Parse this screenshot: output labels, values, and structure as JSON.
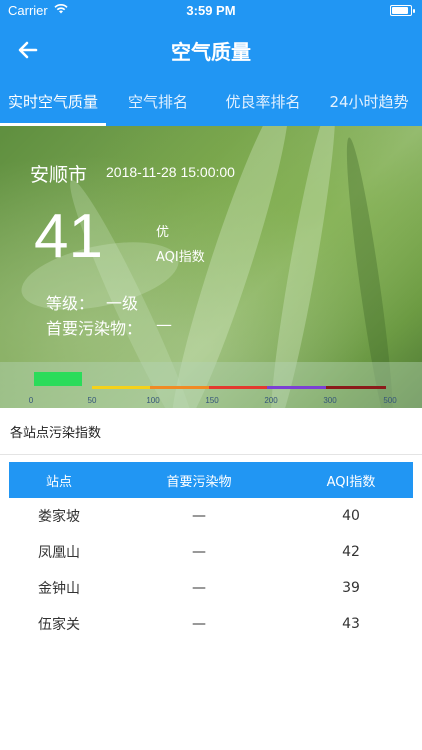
{
  "status_bar": {
    "carrier": "Carrier",
    "time": "3:59 PM"
  },
  "nav": {
    "title": "空气质量"
  },
  "tabs": [
    {
      "label": "实时空气质量",
      "active": true
    },
    {
      "label": "空气排名",
      "active": false
    },
    {
      "label": "优良率排名",
      "active": false
    },
    {
      "label": "24小时趋势",
      "active": false
    }
  ],
  "hero": {
    "city": "安顺市",
    "datetime": "2018-11-28 15:00:00",
    "aqi": "41",
    "quality": "优",
    "aqi_label": "AQI指数",
    "level_label": "等级：",
    "level_value": "一级",
    "pollutant_label": "首要污染物：",
    "pollutant_value": "—",
    "scale": {
      "ticks": [
        "0",
        "50",
        "100",
        "150",
        "200",
        "300",
        "500"
      ],
      "colors": [
        "#f5d21a",
        "#f08a24",
        "#e33a2e",
        "#7b3fd4",
        "#8b1a1a"
      ],
      "indicator_color": "#2bdc5a"
    }
  },
  "stations": {
    "title": "各站点污染指数",
    "headers": [
      "站点",
      "首要污染物",
      "AQI指数"
    ],
    "rows": [
      [
        "娄家坡",
        "—",
        "40"
      ],
      [
        "凤凰山",
        "—",
        "42"
      ],
      [
        "金钟山",
        "—",
        "39"
      ],
      [
        "伍家关",
        "—",
        "43"
      ]
    ]
  },
  "colors": {
    "primary": "#2196f3"
  }
}
